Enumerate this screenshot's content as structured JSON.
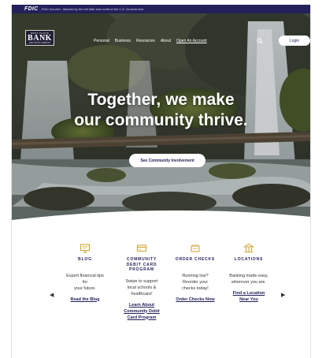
{
  "fdic": {
    "logo": "FDIC",
    "text": "FDIC-Insured - Backed by the full faith and credit of the U.S. Government"
  },
  "logo": {
    "top": "WEST PLAINS",
    "main": "BANK",
    "bottom": "AND TRUST COMPANY"
  },
  "nav": {
    "items": [
      {
        "label": "Personal"
      },
      {
        "label": "Business"
      },
      {
        "label": "Resources"
      },
      {
        "label": "About"
      },
      {
        "label": "Open An Account"
      }
    ],
    "login_label": "Login",
    "search_icon": "search-icon"
  },
  "hero": {
    "headline_line1": "Together, we make",
    "headline_line2": "our community thrive.",
    "cta_label": "See Community Involvement",
    "slides_total": 4,
    "active_slide": 1
  },
  "features": {
    "cards": [
      {
        "icon": "monitor-icon",
        "title": "BLOG",
        "desc_lines": [
          "Expert financial tips",
          "for",
          "your future."
        ],
        "link_lines": [
          "Read the Blog"
        ]
      },
      {
        "icon": "card-icon",
        "title_lines": [
          "COMMUNITY",
          "DEBIT CARD",
          "PROGRAM"
        ],
        "desc_lines": [
          "Swipe to support",
          "local schools &",
          "healthcare!"
        ],
        "link_lines": [
          "Learn About",
          "Community Debit",
          "Card Program"
        ]
      },
      {
        "icon": "checks-icon",
        "title": "ORDER CHECKS",
        "desc_lines": [
          "Running low?",
          "Reorder your",
          "checks today!"
        ],
        "link_lines": [
          "Order Checks Now"
        ]
      },
      {
        "icon": "bank-building-icon",
        "title": "LOCATIONS",
        "desc_lines": [
          "Banking made easy,",
          "wherever you are."
        ],
        "link_lines": [
          "Find a Location",
          "Near You"
        ]
      }
    ],
    "prev_arrow": "◀",
    "next_arrow": "▶"
  },
  "colors": {
    "brand_navy": "#23205a",
    "accent_gold": "#c9a227"
  }
}
